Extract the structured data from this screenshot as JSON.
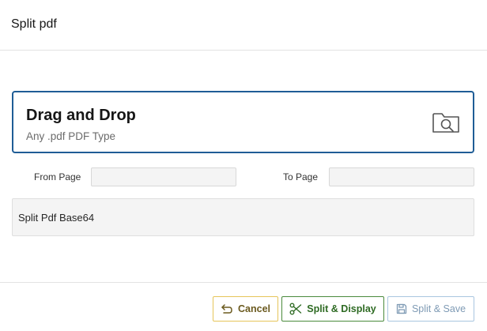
{
  "dialog": {
    "title": "Split pdf"
  },
  "dropzone": {
    "title": "Drag and Drop",
    "subtitle": "Any .pdf PDF Type",
    "icon": "folder-search-icon"
  },
  "fields": {
    "from_page": {
      "label": "From Page",
      "value": ""
    },
    "to_page": {
      "label": "To Page",
      "value": ""
    },
    "base64": {
      "label": "Split Pdf Base64"
    }
  },
  "footer": {
    "cancel_label": "Cancel",
    "cancel_icon": "undo-arrow-icon",
    "display_label": "Split & Display",
    "display_icon": "scissors-icon",
    "save_label": "Split & Save",
    "save_icon": "save-icon"
  },
  "colors": {
    "dropzone_border": "#1f5d96",
    "cancel_border": "#e6c55a",
    "display_border": "#4a8a3c",
    "save_border": "#a9c6e0"
  }
}
